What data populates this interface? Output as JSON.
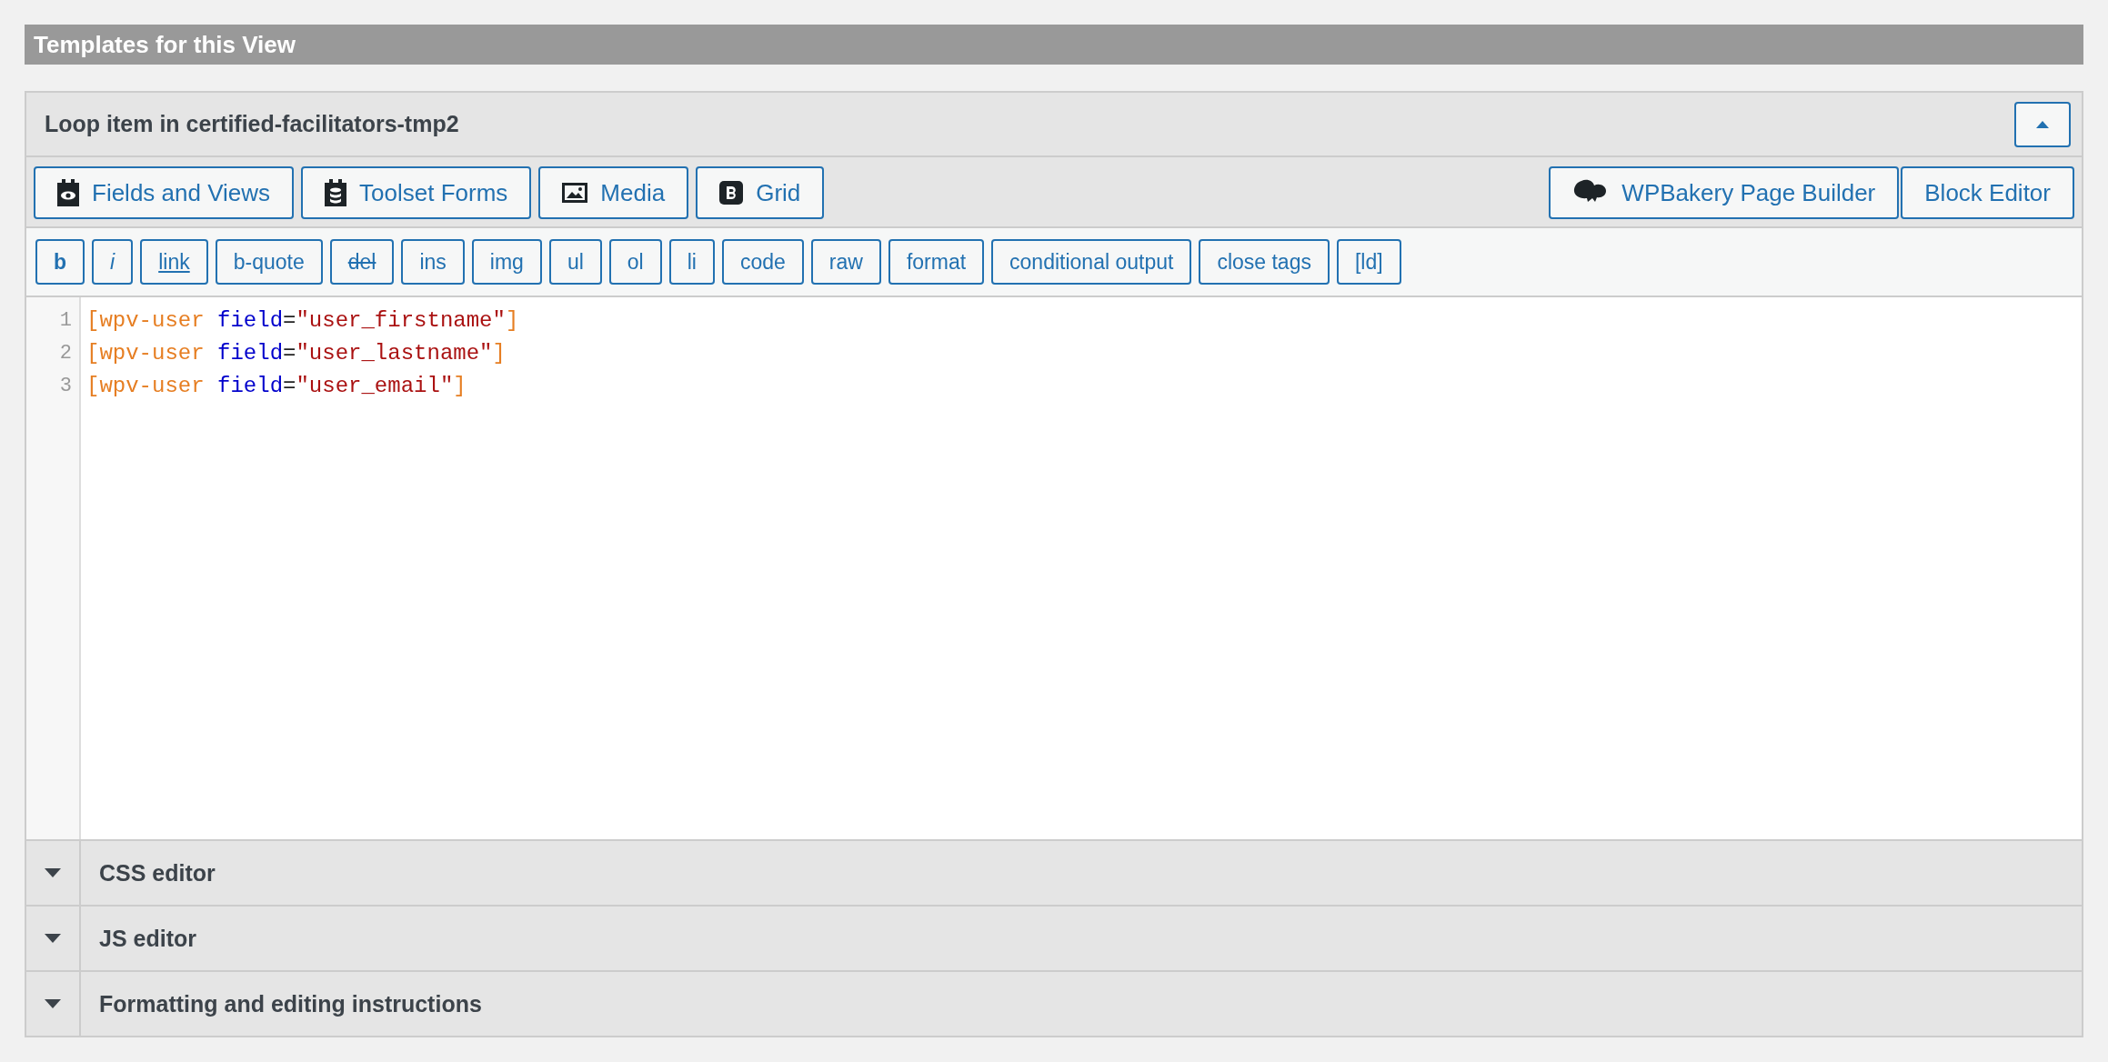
{
  "section_title": "Templates for this View",
  "panel": {
    "title": "Loop item in certified-facilitators-tmp2",
    "expanded": true
  },
  "toolbar_left": [
    {
      "label": "Fields and Views",
      "kind": "fields"
    },
    {
      "label": "Toolset Forms",
      "kind": "forms"
    },
    {
      "label": "Media",
      "kind": "media"
    },
    {
      "label": "Grid",
      "kind": "grid"
    }
  ],
  "toolbar_right": [
    {
      "label": "WPBakery Page Builder",
      "kind": "builder"
    },
    {
      "label": "Block Editor",
      "kind": "text"
    }
  ],
  "quicktags": [
    {
      "label": "b",
      "kind": "bold"
    },
    {
      "label": "i",
      "kind": "italic"
    },
    {
      "label": "link",
      "kind": "underline"
    },
    {
      "label": "b-quote",
      "kind": "plain"
    },
    {
      "label": "del",
      "kind": "strike"
    },
    {
      "label": "ins",
      "kind": "plain"
    },
    {
      "label": "img",
      "kind": "plain"
    },
    {
      "label": "ul",
      "kind": "plain"
    },
    {
      "label": "ol",
      "kind": "plain"
    },
    {
      "label": "li",
      "kind": "plain"
    },
    {
      "label": "code",
      "kind": "plain"
    },
    {
      "label": "raw",
      "kind": "plain"
    },
    {
      "label": "format",
      "kind": "plain"
    },
    {
      "label": "conditional output",
      "kind": "plain"
    },
    {
      "label": "close tags",
      "kind": "plain"
    },
    {
      "label": "[ld]",
      "kind": "plain"
    }
  ],
  "code_lines": [
    {
      "number": "1",
      "tokens": [
        {
          "kind": "tag",
          "text": "[wpv-user"
        },
        {
          "kind": "attr",
          "text": " field"
        },
        {
          "kind": "plain",
          "text": "="
        },
        {
          "kind": "string",
          "text": "\"user_firstname\""
        },
        {
          "kind": "tag",
          "text": "]"
        }
      ]
    },
    {
      "number": "2",
      "tokens": [
        {
          "kind": "tag",
          "text": "[wpv-user"
        },
        {
          "kind": "attr",
          "text": " field"
        },
        {
          "kind": "plain",
          "text": "="
        },
        {
          "kind": "string",
          "text": "\"user_lastname\""
        },
        {
          "kind": "tag",
          "text": "]"
        }
      ]
    },
    {
      "number": "3",
      "tokens": [
        {
          "kind": "tag",
          "text": "[wpv-user"
        },
        {
          "kind": "attr",
          "text": " field"
        },
        {
          "kind": "plain",
          "text": "="
        },
        {
          "kind": "string",
          "text": "\"user_email\""
        },
        {
          "kind": "tag",
          "text": "]"
        }
      ]
    }
  ],
  "sections": [
    {
      "title": "CSS editor",
      "expanded": false
    },
    {
      "title": "JS editor",
      "expanded": false
    },
    {
      "title": "Formatting and editing instructions",
      "expanded": false
    }
  ]
}
